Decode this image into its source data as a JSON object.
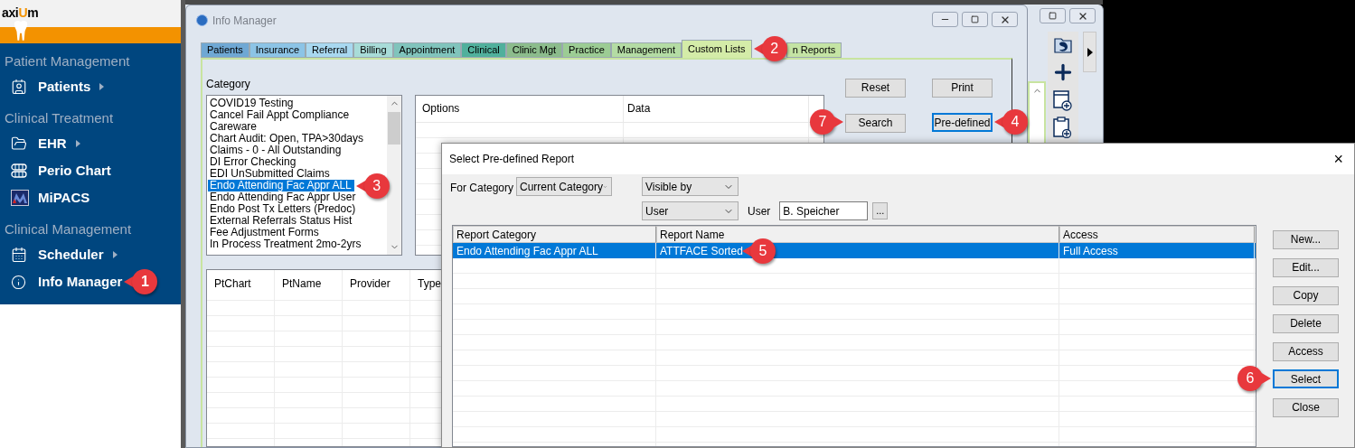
{
  "sidebar": {
    "logo": [
      {
        "text": "axi",
        "accent": false
      },
      {
        "text": "U",
        "accent": true
      },
      {
        "text": "m",
        "accent": false
      }
    ],
    "sections": [
      {
        "title": "Patient Management",
        "items": [
          {
            "label": "Patients",
            "submenu": true
          }
        ]
      },
      {
        "title": "Clinical Treatment",
        "items": [
          {
            "label": "EHR",
            "submenu": true
          },
          {
            "label": "Perio Chart",
            "submenu": false
          },
          {
            "label": "MiPACS",
            "submenu": false
          }
        ]
      },
      {
        "title": "Clinical Management",
        "items": [
          {
            "label": "Scheduler",
            "submenu": true
          },
          {
            "label": "Info Manager",
            "submenu": false,
            "callout": {
              "number": "1"
            }
          }
        ]
      }
    ]
  },
  "info_manager": {
    "title": "Info Manager",
    "tabs": [
      {
        "label": "Patients",
        "color": "#6fa8d4",
        "selected": false
      },
      {
        "label": "Insurance",
        "color": "#8cc4e6",
        "selected": false
      },
      {
        "label": "Referral",
        "color": "#a8d8f0",
        "selected": false
      },
      {
        "label": "Billing",
        "color": "#a8dcd8",
        "selected": false
      },
      {
        "label": "Appointment",
        "color": "#80c4bc",
        "selected": false
      },
      {
        "label": "Clinical",
        "color": "#50b09c",
        "selected": false
      },
      {
        "label": "Clinic Mgt",
        "color": "#8cbc8c",
        "selected": false
      },
      {
        "label": "Practice",
        "color": "#9ccc94",
        "selected": false
      },
      {
        "label": "Management",
        "color": "#b4dca4",
        "selected": false
      },
      {
        "label": "Custom Lists",
        "color": "#d4eca8",
        "selected": true,
        "callout": {
          "number": "2"
        }
      },
      {
        "label": "n Reports",
        "color": "#c4e4a4",
        "selected": false
      }
    ],
    "category_label": "Category",
    "categories": [
      {
        "label": "COVID19 Testing",
        "selected": false
      },
      {
        "label": "Cancel Fail Appt Compliance",
        "selected": false
      },
      {
        "label": "Careware",
        "selected": false
      },
      {
        "label": "Chart Audit: Open, TPA>30days",
        "selected": false
      },
      {
        "label": "Claims - 0 - All Outstanding",
        "selected": false
      },
      {
        "label": "DI Error Checking",
        "selected": false
      },
      {
        "label": "EDI UnSubmitted Claims",
        "selected": false
      },
      {
        "label": "Endo Attending Fac Appr ALL",
        "selected": true,
        "callout": {
          "number": "3"
        }
      },
      {
        "label": "Endo Attending Fac Appr User",
        "selected": false
      },
      {
        "label": "Endo Post Tx Letters (Predoc)",
        "selected": false
      },
      {
        "label": "External Referrals Status Hist",
        "selected": false
      },
      {
        "label": "Fee Adjustment Forms",
        "selected": false
      },
      {
        "label": "In Process Treatment 2mo-2yrs",
        "selected": false
      }
    ],
    "options_columns": [
      "Options",
      "Data"
    ],
    "buttons": [
      {
        "label": "Reset",
        "focused": false
      },
      {
        "label": "Print",
        "focused": false
      },
      {
        "label": "Search",
        "focused": false,
        "callout": {
          "number": "7"
        }
      },
      {
        "label": "Pre-defined",
        "focused": true,
        "callout": {
          "number": "4"
        }
      }
    ],
    "results_columns": [
      "PtChart",
      "PtName",
      "Provider",
      "Type"
    ]
  },
  "dialog": {
    "title": "Select Pre-defined Report",
    "close": "×",
    "for_category_label": "For Category",
    "for_category": "Current Category",
    "visible_by": "Visible by",
    "user_filter": "User",
    "user_label": "User",
    "user_value": "B. Speicher",
    "browse_button": "...",
    "columns": [
      "Report Category",
      "Report Name",
      "Access"
    ],
    "rows": [
      {
        "selected": true,
        "cells": [
          {
            "text": "Endo Attending Fac Appr ALL"
          },
          {
            "text": "ATTFACE Sorted",
            "callout": {
              "number": "5"
            }
          },
          {
            "text": "Full Access"
          }
        ]
      }
    ],
    "buttons": [
      {
        "label": "New...",
        "focused": false
      },
      {
        "label": "Edit...",
        "focused": false
      },
      {
        "label": "Copy",
        "focused": false
      },
      {
        "label": "Delete",
        "focused": false
      },
      {
        "label": "Access",
        "focused": false
      },
      {
        "label": "Select",
        "focused": true,
        "callout": {
          "number": "6"
        }
      },
      {
        "label": "Close",
        "focused": false
      }
    ]
  }
}
